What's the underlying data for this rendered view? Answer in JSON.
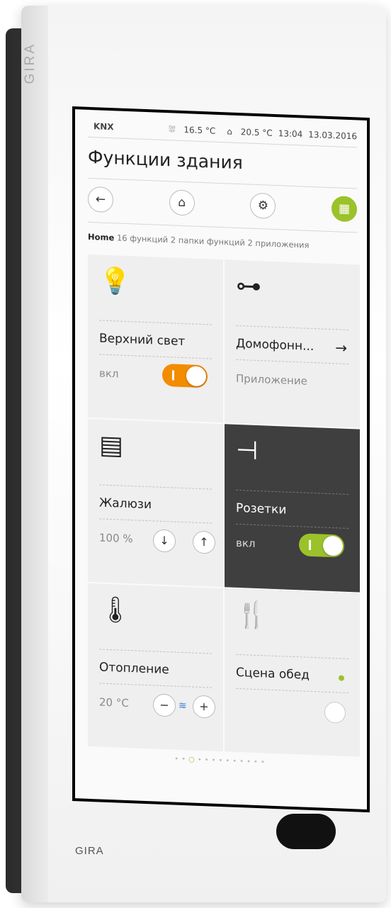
{
  "device": {
    "edge_brand": "GIRA",
    "bottom_brand": "GIRA"
  },
  "status_bar": {
    "brand": "KNX",
    "outdoor_temp": "16.5 °C",
    "indoor_temp": "20.5 °C",
    "time": "13:04",
    "date": "13.03.2016"
  },
  "page": {
    "title": "Функции здания"
  },
  "nav": {
    "items": [
      {
        "icon": "back-arrow-icon",
        "glyph": "←"
      },
      {
        "icon": "home-icon",
        "glyph": "⌂"
      },
      {
        "icon": "settings-gear-icon",
        "glyph": "⚙"
      },
      {
        "icon": "grid-menu-icon",
        "glyph": "▦"
      }
    ]
  },
  "breadcrumb": {
    "home": "Home",
    "summary": "16 функций 2 папки функций 2 приложения"
  },
  "tiles": [
    {
      "name": "Верхний свет",
      "status": "вкл",
      "icon": "light-bulb-icon",
      "glyph": "💡"
    },
    {
      "name": "Домофонн...",
      "status": "Приложение",
      "icon": "key-icon",
      "glyph": "⊶",
      "arrow": "→"
    },
    {
      "name": "Жалюзи",
      "status": "100 %",
      "icon": "blinds-icon",
      "glyph": "▤"
    },
    {
      "name": "Розетки",
      "status": "вкл",
      "icon": "socket-plug-icon",
      "glyph": "⊣"
    },
    {
      "name": "Отопление",
      "status": "20 °C",
      "icon": "thermometer-icon",
      "glyph": "🌡"
    },
    {
      "name": "Сцена обед",
      "status": "",
      "icon": "fork-knife-icon",
      "glyph": "🍴"
    }
  ],
  "colors": {
    "accent_green": "#9bc22a",
    "accent_orange": "#f28c00",
    "dark_tile": "#3f3f3f"
  },
  "pager": {
    "total_pages": 13,
    "current_page": 3
  }
}
